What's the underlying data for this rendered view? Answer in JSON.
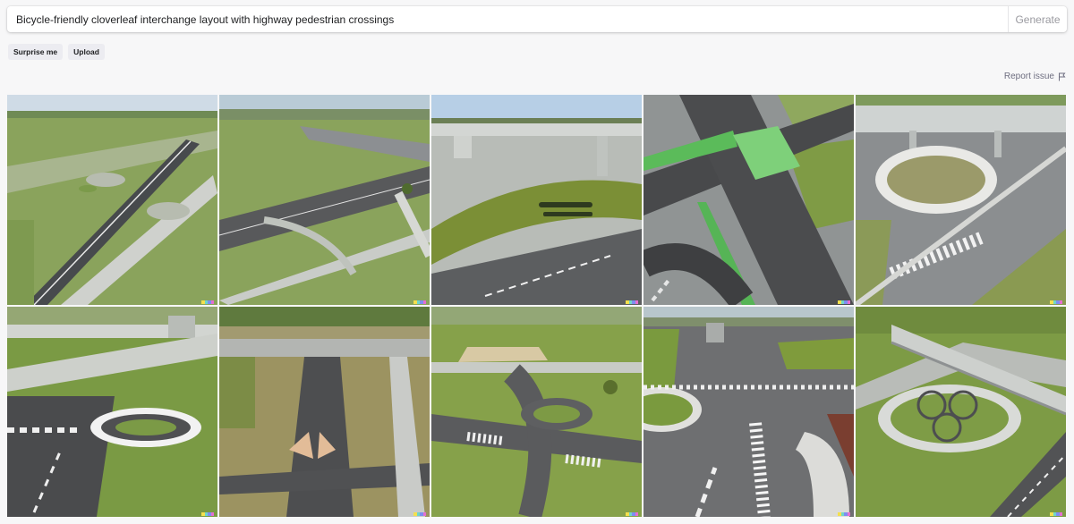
{
  "prompt": {
    "value": "Bicycle-friendly cloverleaf interchange layout with highway pedestrian crossings",
    "placeholder": ""
  },
  "actions": {
    "generate_label": "Generate",
    "surprise_label": "Surprise me",
    "upload_label": "Upload",
    "report_label": "Report issue"
  },
  "icons": {
    "report": "flag-icon"
  },
  "colors": {
    "accent_text": "#202123",
    "muted_text": "#9a9aa0",
    "pill_bg": "#ececf1",
    "badge": [
      "#f4e04d",
      "#6fd6c8",
      "#7e8ef0",
      "#e56fd0",
      "#f08a5d"
    ]
  },
  "images": [
    {
      "scene": "aerial-park-roads"
    },
    {
      "scene": "overpass-curved-roads"
    },
    {
      "scene": "bridge-with-grass-island"
    },
    {
      "scene": "green-bike-crossing"
    },
    {
      "scene": "roundabout-under-overpass"
    },
    {
      "scene": "bridge-zebra-roundabout"
    },
    {
      "scene": "underpass-intersection"
    },
    {
      "scene": "aerial-intersection-crosswalks"
    },
    {
      "scene": "overpass-zebra-lanes"
    },
    {
      "scene": "flyover-clover-park"
    }
  ]
}
